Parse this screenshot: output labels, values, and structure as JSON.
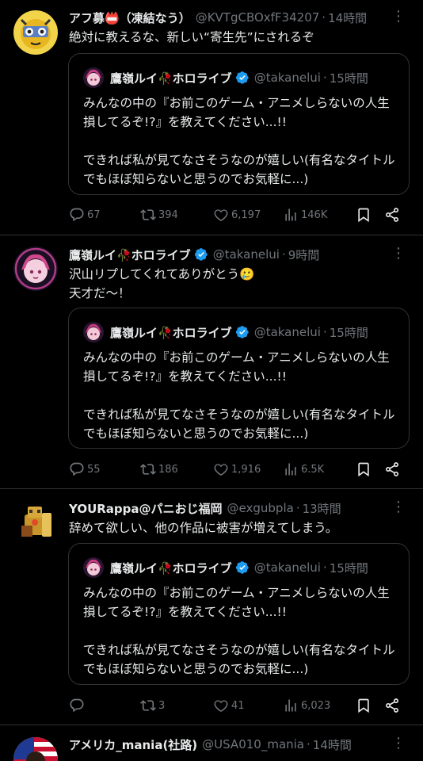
{
  "tweets": [
    {
      "name": "アフ募📛（凍結なう）",
      "handle": "@KVTgCBOxfF34207",
      "time": "14時間",
      "text": "絶対に教えるな、新しい“寄生先”にされるぞ",
      "quote": {
        "name": "鷹嶺ルイ🥀ホロライブ",
        "handle": "@takanelui",
        "time": "15時間",
        "line1": "みんなの中の『お前このゲーム・アニメしらないの人生損してるぞ!?』を教えてください...!!",
        "line2": "できれば私が見てなさそうなのが嬉しい(有名なタイトルでもほぼ知らないと思うのでお気軽に...)"
      },
      "replies": "67",
      "retweets": "394",
      "likes": "6,197",
      "views": "146K"
    },
    {
      "name": "鷹嶺ルイ🥀ホロライブ",
      "handle": "@takanelui",
      "time": "9時間",
      "text_line1": "沢山リプしてくれてありがとう🥲",
      "text_line2": "天才だ〜！",
      "quote": {
        "name": "鷹嶺ルイ🥀ホロライブ",
        "handle": "@takanelui",
        "time": "15時間",
        "line1": "みんなの中の『お前このゲーム・アニメしらないの人生損してるぞ!?』を教えてください...!!",
        "line2": "できれば私が見てなさそうなのが嬉しい(有名なタイトルでもほぼ知らないと思うのでお気軽に...)"
      },
      "replies": "55",
      "retweets": "186",
      "likes": "1,916",
      "views": "6.5K"
    },
    {
      "name": "YOURappa@パニおじ福岡",
      "handle": "@exgubpla",
      "time": "13時間",
      "text": "辞めて欲しい、他の作品に被害が増えてしまう。",
      "quote": {
        "name": "鷹嶺ルイ🥀ホロライブ",
        "handle": "@takanelui",
        "time": "15時間",
        "line1": "みんなの中の『お前このゲーム・アニメしらないの人生損してるぞ!?』を教えてください...!!",
        "line2": "できれば私が見てなさそうなのが嬉しい(有名なタイトルでもほぼ知らないと思うのでお気軽に...)"
      },
      "replies": "",
      "retweets": "3",
      "likes": "41",
      "views": "6,023"
    },
    {
      "name": "アメリカ_mania(社路)",
      "handle": "@USA010_mania",
      "time": "14時間"
    }
  ],
  "sep": "·",
  "more_glyph": "⋮",
  "colors": {
    "background": "#000000",
    "text": "#e7e9ea",
    "muted": "#71767b",
    "border": "#2f3336",
    "verified": "#1d9bf0"
  }
}
